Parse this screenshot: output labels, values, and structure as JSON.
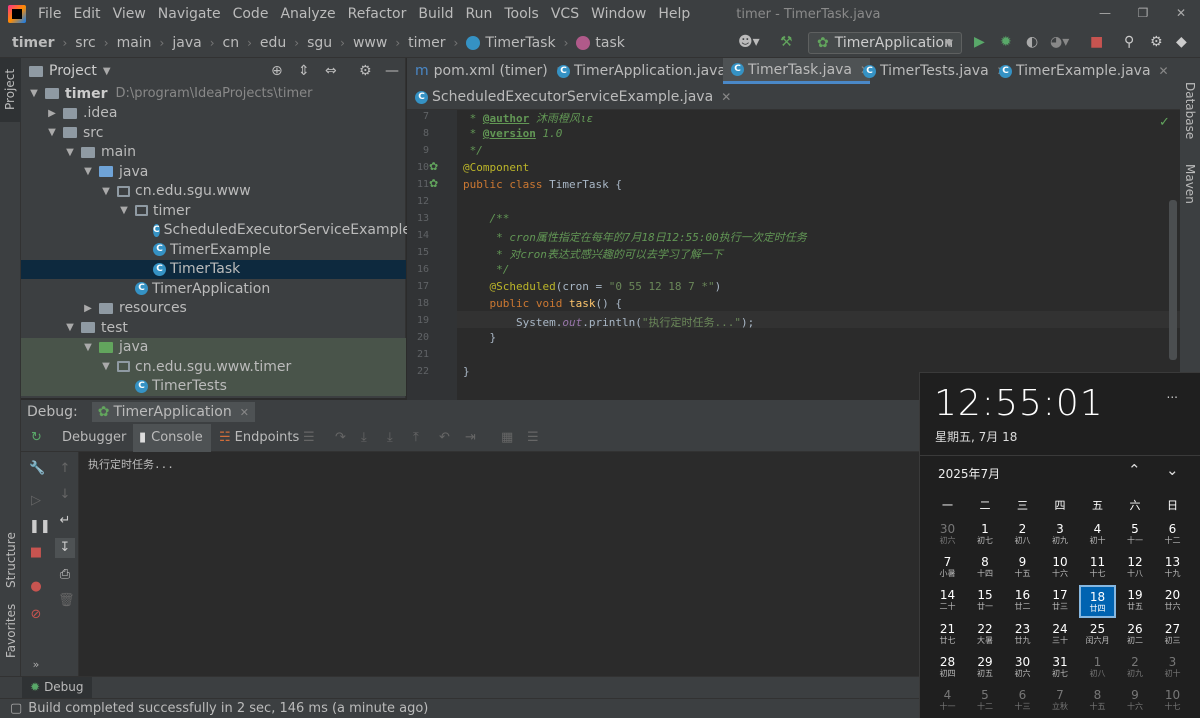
{
  "menubar": {
    "items": [
      "File",
      "Edit",
      "View",
      "Navigate",
      "Code",
      "Analyze",
      "Refactor",
      "Build",
      "Run",
      "Tools",
      "VCS",
      "Window",
      "Help"
    ],
    "title": "timer - TimerTask.java"
  },
  "breadcrumbs": [
    "timer",
    "src",
    "main",
    "java",
    "cn",
    "edu",
    "sgu",
    "www",
    "timer",
    "TimerTask",
    "task"
  ],
  "run_config": "TimerApplication",
  "left_strip": {
    "project": "Project",
    "structure": "Structure",
    "favorites": "Favorites"
  },
  "right_strip": {
    "database": "Database",
    "maven": "Maven"
  },
  "project_panel": {
    "header": "Project",
    "tree": [
      {
        "label": "timer",
        "extra": "D:\\program\\IdeaProjects\\timer"
      },
      {
        "label": ".idea"
      },
      {
        "label": "src"
      },
      {
        "label": "main"
      },
      {
        "label": "java"
      },
      {
        "label": "cn.edu.sgu.www"
      },
      {
        "label": "timer"
      },
      {
        "label": "ScheduledExecutorServiceExample"
      },
      {
        "label": "TimerExample"
      },
      {
        "label": "TimerTask"
      },
      {
        "label": "TimerApplication"
      },
      {
        "label": "resources"
      },
      {
        "label": "test"
      },
      {
        "label": "java"
      },
      {
        "label": "cn.edu.sgu.www.timer"
      },
      {
        "label": "TimerTests"
      }
    ]
  },
  "editor_tabs": [
    "pom.xml (timer)",
    "TimerApplication.java",
    "TimerTask.java",
    "TimerTests.java",
    "TimerExample.java",
    "ScheduledExecutorServiceExample.java"
  ],
  "editor": {
    "line_numbers": [
      "7",
      "8",
      "9",
      "10",
      "11",
      "12",
      "13",
      "14",
      "15",
      "16",
      "17",
      "18",
      "19",
      "20",
      "21",
      "22"
    ],
    "lines": {
      "l7a": " * ",
      "l7b": "@author",
      "l7c": " 沐雨橙风ιε",
      "l8a": " * ",
      "l8b": "@version",
      "l8c": " 1.0",
      "l9": " */",
      "l10": "@Component",
      "l11a": "public class ",
      "l11b": "TimerTask {",
      "l13": "    /**",
      "l14": "     * cron属性指定在每年的7月18日12:55:00执行一次定时任务",
      "l15": "     * 对cron表达式感兴趣的可以去学习了解一下",
      "l16": "     */",
      "l17a": "    @Scheduled",
      "l17b": "(cron = ",
      "l17c": "\"0 55 12 18 7 *\"",
      "l17d": ")",
      "l18a": "    public void ",
      "l18b": "task",
      "l18c": "() {",
      "l19a": "        System.",
      "l19b": "out",
      "l19c": ".println(",
      "l19d": "\"执行定时任务...\"",
      "l19e": ");",
      "l20": "    }",
      "l22": "}"
    }
  },
  "debug": {
    "label": "Debug:",
    "session": "TimerApplication",
    "tabs": [
      "Debugger",
      "Console",
      "Endpoints"
    ],
    "console_output": "执行定时任务..."
  },
  "bottom_tab": "Debug",
  "status": "Build completed successfully in 2 sec, 146 ms (a minute ago)",
  "calendar": {
    "time": "12:55:01",
    "date": "星期五, 7月 18",
    "month": "2025年7月",
    "more": "...",
    "weekdays": [
      "一",
      "二",
      "三",
      "四",
      "五",
      "六",
      "日"
    ],
    "weeks": [
      [
        [
          "30",
          "初六"
        ],
        [
          "1",
          "初七"
        ],
        [
          "2",
          "初八"
        ],
        [
          "3",
          "初九"
        ],
        [
          "4",
          "初十"
        ],
        [
          "5",
          "十一"
        ],
        [
          "6",
          "十二"
        ]
      ],
      [
        [
          "7",
          "小暑"
        ],
        [
          "8",
          "十四"
        ],
        [
          "9",
          "十五"
        ],
        [
          "10",
          "十六"
        ],
        [
          "11",
          "十七"
        ],
        [
          "12",
          "十八"
        ],
        [
          "13",
          "十九"
        ]
      ],
      [
        [
          "14",
          "二十"
        ],
        [
          "15",
          "廿一"
        ],
        [
          "16",
          "廿二"
        ],
        [
          "17",
          "廿三"
        ],
        [
          "18",
          "廿四"
        ],
        [
          "19",
          "廿五"
        ],
        [
          "20",
          "廿六"
        ]
      ],
      [
        [
          "21",
          "廿七"
        ],
        [
          "22",
          "大暑"
        ],
        [
          "23",
          "廿九"
        ],
        [
          "24",
          "三十"
        ],
        [
          "25",
          "闰六月"
        ],
        [
          "26",
          "初二"
        ],
        [
          "27",
          "初三"
        ]
      ],
      [
        [
          "28",
          "初四"
        ],
        [
          "29",
          "初五"
        ],
        [
          "30",
          "初六"
        ],
        [
          "31",
          "初七"
        ],
        [
          "1",
          "初八"
        ],
        [
          "2",
          "初九"
        ],
        [
          "3",
          "初十"
        ]
      ],
      [
        [
          "4",
          "十一"
        ],
        [
          "5",
          "十二"
        ],
        [
          "6",
          "十三"
        ],
        [
          "7",
          "立秋"
        ],
        [
          "8",
          "十五"
        ],
        [
          "9",
          "十六"
        ],
        [
          "10",
          "十七"
        ]
      ]
    ],
    "today": "18"
  }
}
